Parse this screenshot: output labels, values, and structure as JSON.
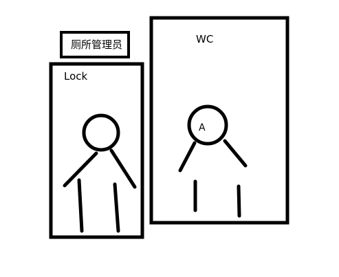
{
  "manager_sign": {
    "label": "厕所管理员"
  },
  "lock_booth": {
    "label": "Lock"
  },
  "wc_booth": {
    "label": "WC",
    "person_label": "A"
  },
  "colors": {
    "stroke": "#000000",
    "background": "#ffffff"
  }
}
